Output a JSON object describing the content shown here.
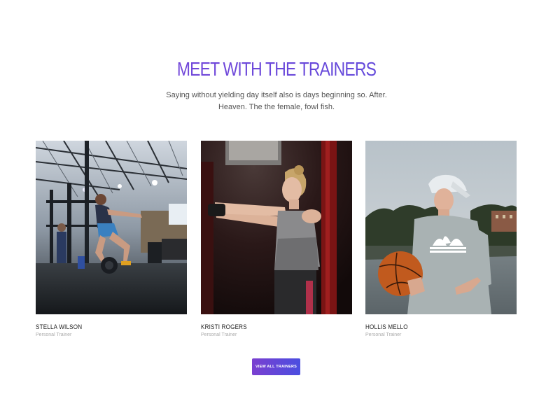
{
  "section": {
    "title": "MEET WITH THE TRAINERS",
    "subtitle": "Saying without yielding day itself also is days beginning so. After. Heaven. The the female, fowl fish."
  },
  "trainers": [
    {
      "name": "STELLA WILSON",
      "role": "Personal Trainer",
      "photo": "woman-crossfit-gym-photo"
    },
    {
      "name": "KRISTI ROGERS",
      "role": "Personal Trainer",
      "photo": "woman-kettlebell-photo"
    },
    {
      "name": "HOLLIS MELLO",
      "role": "Personal Trainer",
      "photo": "man-basketball-photo"
    }
  ],
  "cta": {
    "label": "VIEW ALL TRAINERS"
  },
  "colors": {
    "accent_start": "#7a3fd0",
    "accent_end": "#4b4ee0",
    "title": "#6a3fd6",
    "body_text": "#555555",
    "muted_text": "#aaaaaa"
  }
}
